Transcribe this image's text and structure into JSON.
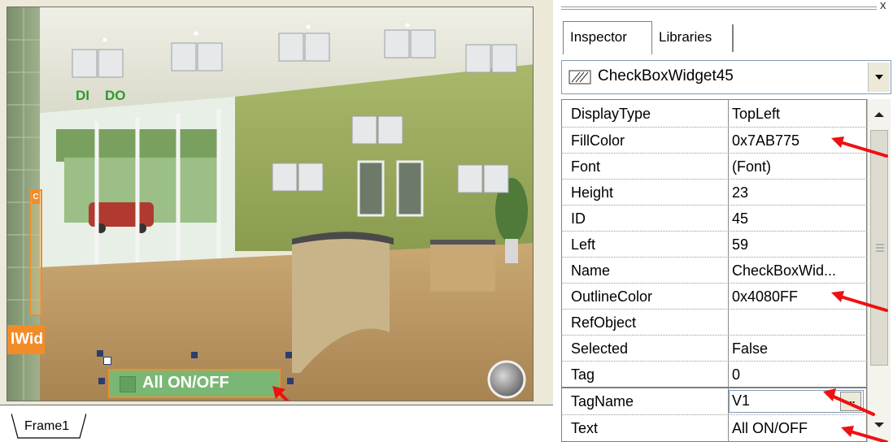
{
  "canvas": {
    "indicators": {
      "di_label": "DI",
      "do_label": "DO"
    },
    "slider_tab_text": "C",
    "partial_widget_label": "lWid",
    "checkbox_widget": {
      "label": "All ON/OFF",
      "fill_color": "#7AB775",
      "outline_color": "#FF8040"
    }
  },
  "frame_tab": {
    "label": "Frame1"
  },
  "inspector": {
    "tabs": [
      {
        "label": "Inspector",
        "active": true
      },
      {
        "label": "Libraries",
        "active": false
      }
    ],
    "selected_object": {
      "name": "CheckBoxWidget45",
      "icon": "checkbox-widget-icon"
    },
    "properties": [
      {
        "name": "DisplayType",
        "value": "TopLeft"
      },
      {
        "name": "FillColor",
        "value": "0x7AB775"
      },
      {
        "name": "Font",
        "value": "(Font)"
      },
      {
        "name": "Height",
        "value": "23"
      },
      {
        "name": "ID",
        "value": "45"
      },
      {
        "name": "Left",
        "value": "59"
      },
      {
        "name": "Name",
        "value": "CheckBoxWid..."
      },
      {
        "name": "OutlineColor",
        "value": "0x4080FF"
      },
      {
        "name": "RefObject",
        "value": ""
      },
      {
        "name": "Selected",
        "value": "False"
      },
      {
        "name": "Tag",
        "value": "0"
      },
      {
        "name": "TagName",
        "value": "V1"
      },
      {
        "name": "Text",
        "value": "All ON/OFF"
      }
    ],
    "ellipsis_button": "...",
    "close_glyph": "x"
  },
  "colors": {
    "highlight_arrow": "#EE1111",
    "panel_border": "#7F9DB9"
  }
}
